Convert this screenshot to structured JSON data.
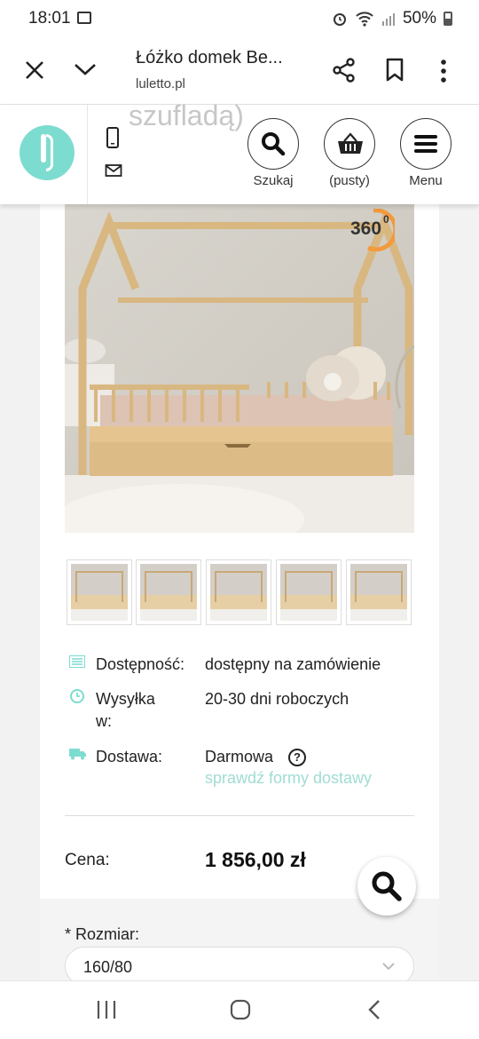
{
  "status_bar": {
    "time": "18:01",
    "battery": "50%",
    "icons": [
      "gallery-icon",
      "alarm-icon",
      "wifi-icon",
      "signal-icon",
      "battery-icon"
    ]
  },
  "browser": {
    "title": "Łóżko domek Be...",
    "domain": "luletto.pl",
    "icons": [
      "close-icon",
      "chevron-down-icon",
      "share-icon",
      "bookmark-icon",
      "more-vert-icon"
    ]
  },
  "site_header": {
    "ghost_text": "szufladą)",
    "search_label": "Szukaj",
    "cart_label": "(pusty)",
    "menu_label": "Menu",
    "icons": [
      "phone-icon",
      "mail-icon",
      "search-icon",
      "basket-icon",
      "hamburger-icon"
    ]
  },
  "product": {
    "badge_360": "360",
    "badge_sup": "0",
    "thumbnails": 5,
    "availability_label": "Dostępność:",
    "availability_value": "dostępny na zamówienie",
    "shipping_label_1": "Wysyłka",
    "shipping_label_2": "w:",
    "shipping_value": "20-30 dni roboczych",
    "delivery_label": "Dostawa:",
    "delivery_value": "Darmowa",
    "delivery_help": "?",
    "delivery_link": "sprawdź formy dostawy",
    "price_label": "Cena:",
    "price_value": "1 856,00 zł",
    "size_label": "* Rozmiar:",
    "size_value": "160/80"
  },
  "colors": {
    "accent": "#7ddcd0",
    "link": "#9fdcd3",
    "badge_orange": "#f29a3c"
  }
}
